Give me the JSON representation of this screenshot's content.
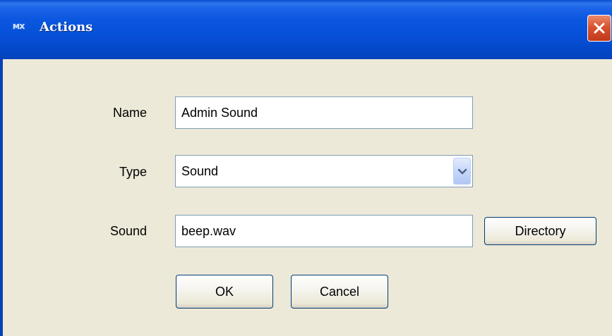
{
  "window": {
    "title": "Actions",
    "app_icon_text": "MX",
    "close_icon": "close-icon"
  },
  "form": {
    "name": {
      "label": "Name",
      "value": "Admin Sound"
    },
    "type": {
      "label": "Type",
      "value": "Sound",
      "dropdown_icon": "chevron-down-icon"
    },
    "sound": {
      "label": "Sound",
      "value": "beep.wav",
      "directory_button": "Directory"
    }
  },
  "buttons": {
    "ok": "OK",
    "cancel": "Cancel"
  },
  "colors": {
    "titlebar": "#0650d8",
    "dialog_background": "#ece9d8",
    "close_button": "#d9532f",
    "field_border": "#7f9db9",
    "button_border": "#003c74"
  }
}
